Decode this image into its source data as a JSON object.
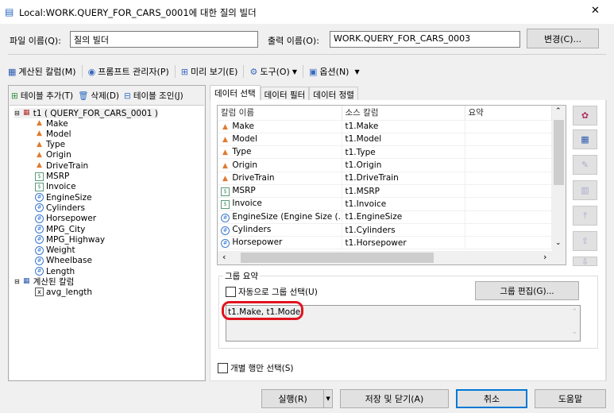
{
  "window": {
    "title": "Local:WORK.QUERY_FOR_CARS_0001에 대한 질의 빌더",
    "close": "✕"
  },
  "file": {
    "label": "파일 이름(Q):",
    "value": "질의 빌더",
    "output_label": "출력 이름(O):",
    "output_value": "WORK.QUERY_FOR_CARS_0003",
    "change_button": "변경(C)..."
  },
  "toolbar": {
    "computed": "계산된 칼럼(M)",
    "prompt": "프롬프트 관리자(P)",
    "preview": "미리 보기(E)",
    "tools": "도구(O)",
    "options": "옵션(N)"
  },
  "left": {
    "add_table": "테이블 추가(T)",
    "delete": "삭제(D)",
    "join": "테이블 조인(J)",
    "tree": {
      "table": "t1 ( QUERY_FOR_CARS_0001 )",
      "columns": [
        {
          "name": "Make",
          "type": "char"
        },
        {
          "name": "Model",
          "type": "char"
        },
        {
          "name": "Type",
          "type": "char"
        },
        {
          "name": "Origin",
          "type": "char"
        },
        {
          "name": "DriveTrain",
          "type": "char"
        },
        {
          "name": "MSRP",
          "type": "currency"
        },
        {
          "name": "Invoice",
          "type": "currency"
        },
        {
          "name": "EngineSize",
          "type": "num"
        },
        {
          "name": "Cylinders",
          "type": "num"
        },
        {
          "name": "Horsepower",
          "type": "num"
        },
        {
          "name": "MPG_City",
          "type": "num"
        },
        {
          "name": "MPG_Highway",
          "type": "num"
        },
        {
          "name": "Weight",
          "type": "num"
        },
        {
          "name": "Wheelbase",
          "type": "num"
        },
        {
          "name": "Length",
          "type": "num"
        }
      ],
      "computed_label": "계산된 칼럼",
      "computed_items": [
        "avg_length"
      ]
    }
  },
  "tabs": [
    "데이터 선택",
    "데이터 필터",
    "데이터 정렬"
  ],
  "grid": {
    "headers": [
      "칼럼 이름",
      "소스 칼럼",
      "요약"
    ],
    "rows": [
      [
        "Make",
        "t1.Make",
        "",
        "char"
      ],
      [
        "Model",
        "t1.Model",
        "",
        "char"
      ],
      [
        "Type",
        "t1.Type",
        "",
        "char"
      ],
      [
        "Origin",
        "t1.Origin",
        "",
        "char"
      ],
      [
        "DriveTrain",
        "t1.DriveTrain",
        "",
        "char"
      ],
      [
        "MSRP",
        "t1.MSRP",
        "",
        "currency"
      ],
      [
        "Invoice",
        "t1.Invoice",
        "",
        "currency"
      ],
      [
        "EngineSize (Engine Size (...",
        "t1.EngineSize",
        "",
        "num"
      ],
      [
        "Cylinders",
        "t1.Cylinders",
        "",
        "num"
      ],
      [
        "Horsepower",
        "t1.Horsepower",
        "",
        "num"
      ]
    ]
  },
  "group": {
    "legend": "그룹 요약",
    "auto_label": "자동으로 그룹 선택(U)",
    "auto_checked": false,
    "edit_button": "그룹 편집(G)...",
    "value": "t1.Make, t1.Model"
  },
  "distinct": {
    "label": "개별 행만 선택(S)",
    "checked": false
  },
  "buttons": {
    "run": "실행(R)",
    "save_close": "저장 및 닫기(A)",
    "cancel": "취소",
    "help": "도움말"
  },
  "colors": {
    "accent": "#0078d7",
    "highlight": "#e0141e"
  }
}
